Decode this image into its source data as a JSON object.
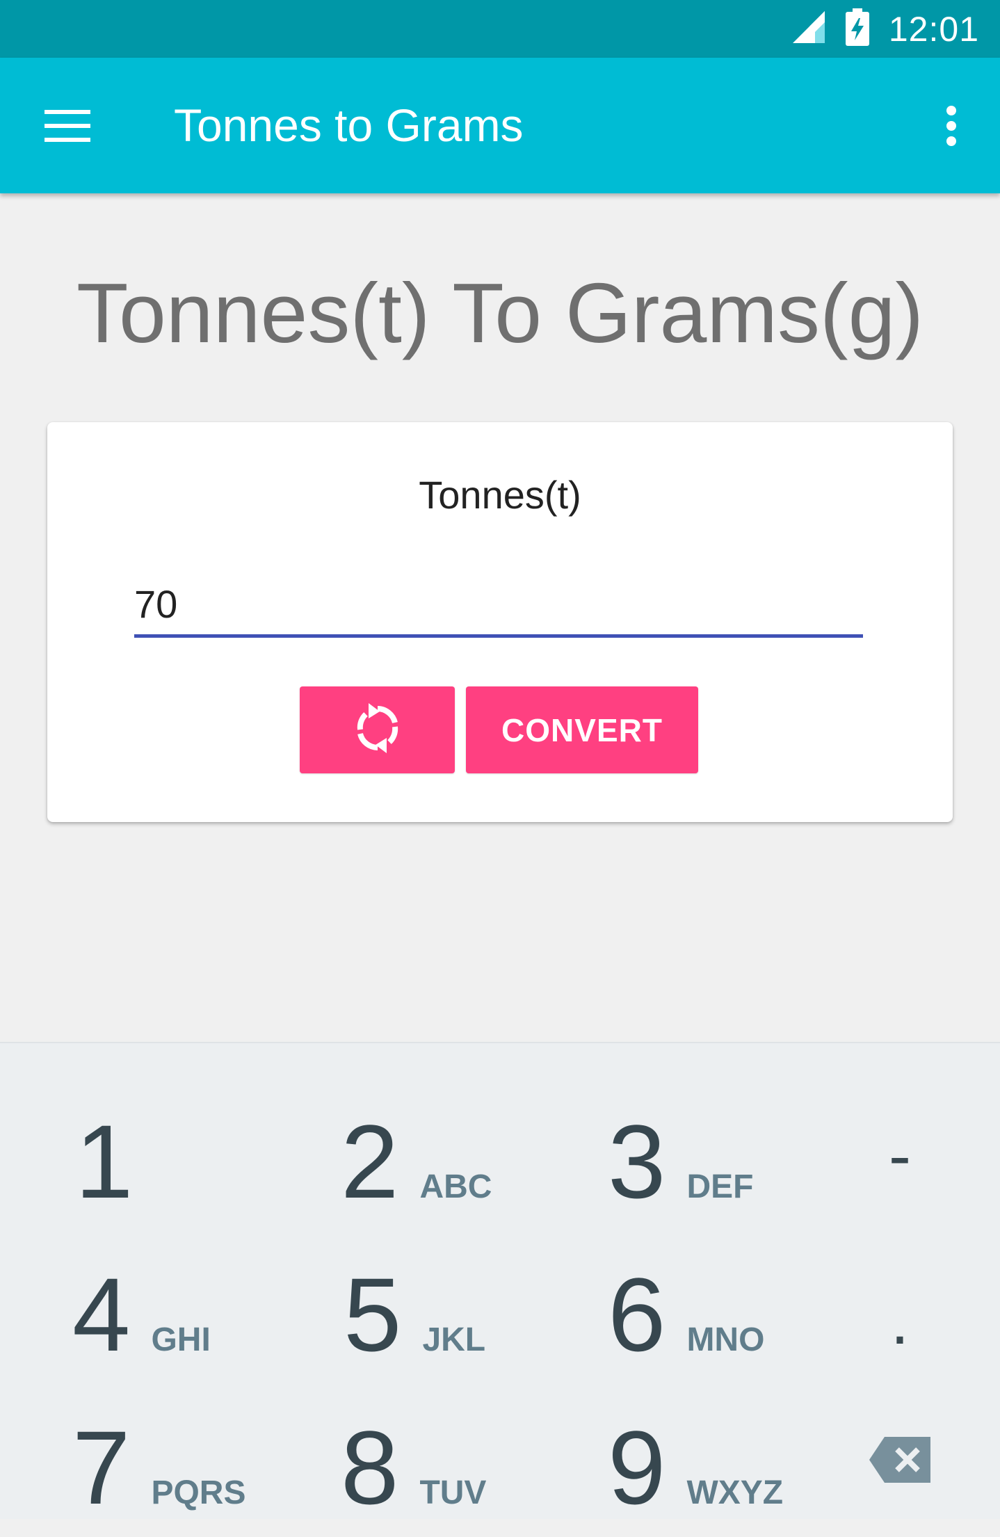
{
  "status_bar": {
    "time": "12:01",
    "signal_icon": "signal-icon",
    "battery_icon": "battery-charging-icon"
  },
  "app_bar": {
    "title": "Tonnes to Grams",
    "menu_icon": "hamburger-menu-icon",
    "overflow_icon": "more-vert-icon",
    "background_color": "#00bcd4"
  },
  "main": {
    "heading": "Tonnes(t) To Grams(g)",
    "card": {
      "input_label": "Tonnes(t)",
      "input_value": "70",
      "swap_icon": "swap-refresh-icon",
      "convert_label": "CONVERT",
      "button_color": "#ff4081",
      "underline_color": "#3f51b5"
    }
  },
  "keyboard": {
    "keys": [
      {
        "digit": "1",
        "letters": ""
      },
      {
        "digit": "2",
        "letters": "ABC"
      },
      {
        "digit": "3",
        "letters": "DEF"
      },
      {
        "digit": "4",
        "letters": "GHI"
      },
      {
        "digit": "5",
        "letters": "JKL"
      },
      {
        "digit": "6",
        "letters": "MNO"
      },
      {
        "digit": "7",
        "letters": "PQRS"
      },
      {
        "digit": "8",
        "letters": "TUV"
      },
      {
        "digit": "9",
        "letters": "WXYZ"
      }
    ],
    "minus": "-",
    "dot": ".",
    "backspace_icon": "backspace-icon"
  }
}
